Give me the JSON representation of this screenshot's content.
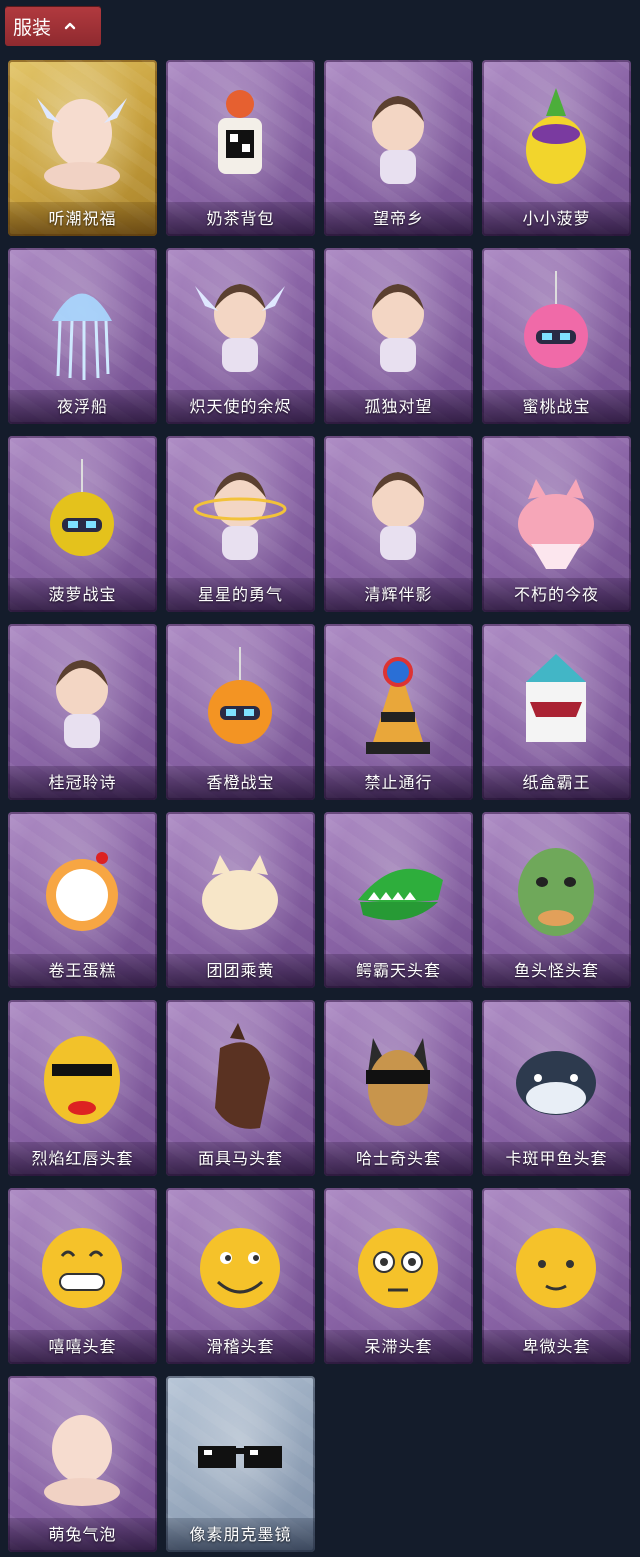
{
  "header": {
    "title": "服装"
  },
  "items": [
    {
      "label": "听潮祝福",
      "icon": "hair-wings-icon",
      "tier": "gold"
    },
    {
      "label": "奶茶背包",
      "icon": "milk-tea-backpack-icon",
      "tier": "purple"
    },
    {
      "label": "望帝乡",
      "icon": "emperor-doll-icon",
      "tier": "purple"
    },
    {
      "label": "小小菠萝",
      "icon": "pineapple-mascot-icon",
      "tier": "purple"
    },
    {
      "label": "夜浮船",
      "icon": "jellyfish-icon",
      "tier": "purple"
    },
    {
      "label": "炽天使的余烬",
      "icon": "angel-doll-icon",
      "tier": "purple"
    },
    {
      "label": "孤独对望",
      "icon": "silver-hair-charm-icon",
      "tier": "purple"
    },
    {
      "label": "蜜桃战宝",
      "icon": "peach-robot-icon",
      "tier": "purple"
    },
    {
      "label": "菠萝战宝",
      "icon": "pineapple-robot-icon",
      "tier": "purple"
    },
    {
      "label": "星星的勇气",
      "icon": "star-prince-charm-icon",
      "tier": "purple"
    },
    {
      "label": "清辉伴影",
      "icon": "moon-dragon-charm-icon",
      "tier": "purple"
    },
    {
      "label": "不朽的今夜",
      "icon": "pink-cat-bowl-icon",
      "tier": "purple"
    },
    {
      "label": "桂冠聆诗",
      "icon": "laurel-charm-icon",
      "tier": "purple"
    },
    {
      "label": "香橙战宝",
      "icon": "orange-robot-icon",
      "tier": "purple"
    },
    {
      "label": "禁止通行",
      "icon": "traffic-cone-icon",
      "tier": "purple"
    },
    {
      "label": "纸盒霸王",
      "icon": "box-dinosaur-icon",
      "tier": "purple"
    },
    {
      "label": "卷王蛋糕",
      "icon": "roll-cake-icon",
      "tier": "purple"
    },
    {
      "label": "团团乘黄",
      "icon": "fluffy-beast-icon",
      "tier": "purple"
    },
    {
      "label": "鳄霸天头套",
      "icon": "crocodile-mask-icon",
      "tier": "purple"
    },
    {
      "label": "鱼头怪头套",
      "icon": "fish-head-mask-icon",
      "tier": "purple"
    },
    {
      "label": "烈焰红唇头套",
      "icon": "yellow-mouse-mask-icon",
      "tier": "purple"
    },
    {
      "label": "面具马头套",
      "icon": "horse-mask-icon",
      "tier": "purple"
    },
    {
      "label": "哈士奇头套",
      "icon": "husky-mask-icon",
      "tier": "purple"
    },
    {
      "label": "卡斑甲鱼头套",
      "icon": "blue-fish-mask-icon",
      "tier": "purple"
    },
    {
      "label": "嘻嘻头套",
      "icon": "grin-emoji-icon",
      "tier": "purple"
    },
    {
      "label": "滑稽头套",
      "icon": "smirk-emoji-icon",
      "tier": "purple"
    },
    {
      "label": "呆滞头套",
      "icon": "stare-emoji-icon",
      "tier": "purple"
    },
    {
      "label": "卑微头套",
      "icon": "timid-emoji-icon",
      "tier": "purple"
    },
    {
      "label": "萌兔气泡",
      "icon": "bubble-hair-icon",
      "tier": "purple"
    },
    {
      "label": "像素朋克墨镜",
      "icon": "pixel-sunglasses-icon",
      "tier": "blue"
    }
  ]
}
